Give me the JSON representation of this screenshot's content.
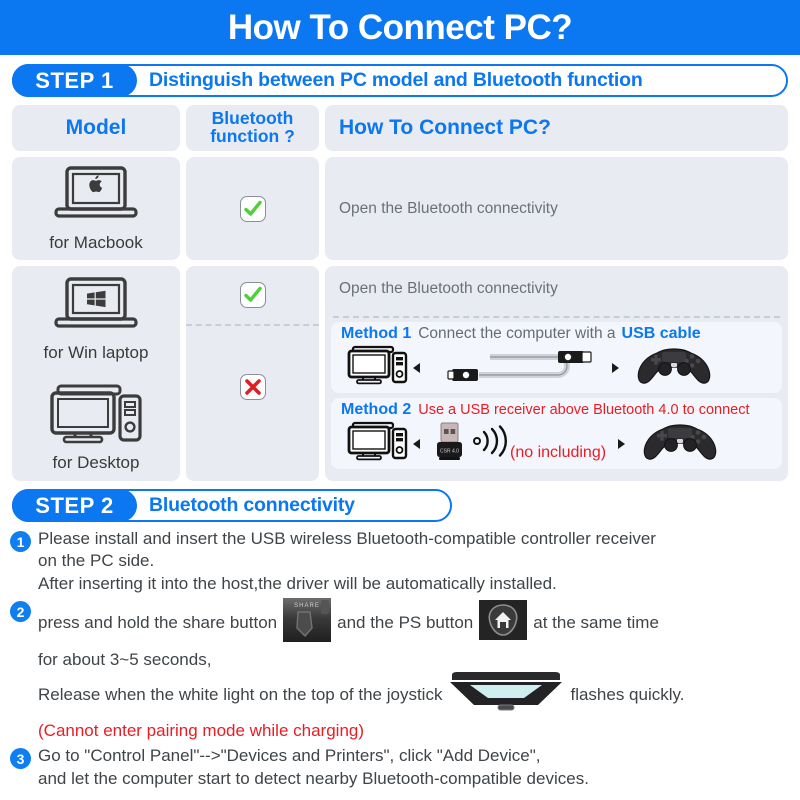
{
  "header": {
    "title": "How To Connect PC?"
  },
  "step1": {
    "badge": "STEP 1",
    "title": "Distinguish between PC model and Bluetooth function"
  },
  "table": {
    "headers": {
      "model": "Model",
      "bluetooth_line1": "Bluetooth",
      "bluetooth_line2": "function ?",
      "how": "How To Connect PC?"
    },
    "rows": [
      {
        "model_label": "for Macbook",
        "model_icon": "macbook-laptop-icon",
        "bluetooth": "yes",
        "bluetooth_icon": "green-check-icon",
        "how_text": "Open the Bluetooth connectivity"
      },
      {
        "model_label": "for Win laptop",
        "model_icon": "windows-laptop-icon",
        "bluetooth": "yes",
        "bluetooth_icon": "green-check-icon",
        "how_text": "Open the Bluetooth connectivity"
      },
      {
        "model_label": "for Desktop",
        "model_icon": "desktop-tower-icon",
        "bluetooth": "no",
        "bluetooth_icon": "red-cross-icon"
      }
    ],
    "methods": [
      {
        "label": "Method 1",
        "desc_plain": "Connect the computer with a",
        "desc_strong": "USB cable",
        "art": [
          "desktop-computer-icon",
          "arrow-left-icon",
          "usb-cable-icon",
          "arrow-right-icon",
          "ps4-controller-icon"
        ]
      },
      {
        "label": "Method 2",
        "desc_plain": "Use a USB receiver above Bluetooth 4.0 to connect",
        "note": "(no including)",
        "dongle_label": "CSR 4.0",
        "art": [
          "desktop-computer-icon",
          "arrow-left-icon",
          "usb-bluetooth-dongle-icon",
          "bluetooth-waves-icon",
          "arrow-right-icon",
          "ps4-controller-icon"
        ]
      }
    ]
  },
  "step2": {
    "badge": "STEP 2",
    "title": "Bluetooth connectivity",
    "items": [
      {
        "num": "1",
        "lines": [
          "Please install and insert the USB wireless Bluetooth-compatible controller receiver",
          "on the PC side.",
          "After inserting it into the host,the driver will be automatically installed."
        ]
      },
      {
        "num": "2",
        "line1_a": "press and hold the share button",
        "line1_b": "and  the PS button",
        "line1_c": "at the same time",
        "line2": "for about 3~5 seconds,",
        "line3_a": "Release when the white light on the top of the joystick",
        "line3_b": "flashes quickly.",
        "line4": "(Cannot enter pairing mode while charging)",
        "share_icon": "ps4-share-button-icon",
        "ps_icon": "ps4-ps-button-icon",
        "lightbar_icon": "ps4-lightbar-icon"
      },
      {
        "num": "3",
        "lines": [
          "Go to \"Control Panel\"-->\"Devices and Printers\", click \"Add Device\",",
          "and let the computer start to detect nearby Bluetooth-compatible devices."
        ]
      }
    ]
  },
  "colors": {
    "brand_blue": "#0b77f0",
    "header_bg": "#0b77f0",
    "cell_bg": "#e8ecf2",
    "method_bg": "#f3f7fd",
    "red": "#ea1c24",
    "green": "#4cd137",
    "body_text": "#3f4448"
  }
}
